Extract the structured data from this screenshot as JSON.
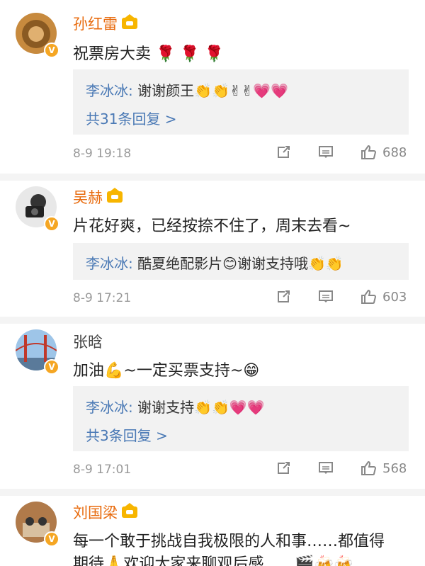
{
  "comments": [
    {
      "name": "孙红雷",
      "text": "祝票房大卖 🌹 🌹 🌹",
      "reply_user": "李冰冰:",
      "reply_text": " 谢谢颜王👏👏✌✌💗💗",
      "more": "共31条回复 >",
      "time": "8-9 19:18",
      "likes": "688"
    },
    {
      "name": "吴赫",
      "text": "片花好爽，已经按捺不住了，周末去看~",
      "reply_user": "李冰冰:",
      "reply_text": " 酷夏绝配影片😊谢谢支持哦👏👏",
      "time": "8-9 17:21",
      "likes": "603"
    },
    {
      "name": "张晗",
      "text": "加油💪~一定买票支持~😁",
      "reply_user": "李冰冰:",
      "reply_text": " 谢谢支持👏👏💗💗",
      "more": "共3条回复 >",
      "time": "8-9 17:01",
      "likes": "568"
    },
    {
      "name": "刘国梁",
      "text": "每一个敢于挑战自我极限的人和事……都值得",
      "text2": "期待🙏欢迎大家来聊观后感……🎬🍻🍻"
    }
  ],
  "colors": {
    "name_orange": "#e86b0e",
    "reply_blue": "#4a79b5",
    "reply_bg": "#f2f2f2",
    "badge": "#f5a623"
  },
  "icons": [
    "share-icon",
    "comment-icon",
    "like-icon",
    "crown-icon",
    "verified-badge-icon"
  ]
}
